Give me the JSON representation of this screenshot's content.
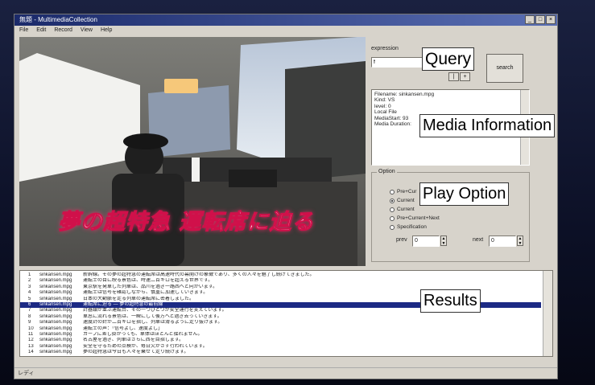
{
  "window": {
    "title": "無題 - MultimediaCollection",
    "controls": [
      "_",
      "□",
      "×"
    ]
  },
  "menu": [
    "File",
    "Edit",
    "Record",
    "View",
    "Help"
  ],
  "video": {
    "caption": "夢の超特急 運転席に迫る"
  },
  "query": {
    "label": "expression",
    "value": "f",
    "nav_prev": "|",
    "nav_next": "+",
    "search_button": "search",
    "callout": "Query"
  },
  "media_info": {
    "lines": [
      "Filename: sinkansen.mpg",
      "Kind: VS",
      "level: 0",
      "Local File",
      "MediaStart: 93",
      "Media Duration:"
    ],
    "callout": "Media Information"
  },
  "play_option": {
    "group_label": "Option",
    "options": [
      "Pre+Cur",
      "Current",
      "Current",
      "Pre+Current+Next",
      "Specification"
    ],
    "selected_index": 1,
    "prev_label": "prev",
    "prev_value": "0",
    "next_label": "next",
    "next_value": "0",
    "callout": "Play Option"
  },
  "results": {
    "rows": [
      {
        "n": "1",
        "file": "sinkansen.mpg",
        "text": "新幹線。その夢の超特急の運転席は高速時代の幕開けの象徴であり、多くの人々を魅了し続けてきました。"
      },
      {
        "n": "2",
        "file": "sinkansen.mpg",
        "text": "運転士の目に映る景色は、時速二百キロを超える世界です。"
      },
      {
        "n": "3",
        "file": "sinkansen.mpg",
        "text": "東京駅を発車した列車は、品川を過ぎ一路西へと向かいます。"
      },
      {
        "n": "4",
        "file": "sinkansen.mpg",
        "text": "運転士は信号を確認しながら、慎重に加速していきます。"
      },
      {
        "n": "5",
        "file": "sinkansen.mpg",
        "text": "日本の大動脈を走る列車の運転席に密着しました。"
      },
      {
        "n": "6",
        "file": "sinkansen.mpg",
        "text": "運転席に迫る ― 夢の超特急の最前線"
      },
      {
        "n": "7",
        "file": "sinkansen.mpg",
        "text": "計器類が並ぶ運転台、その一つひとつが安全運行を支えています。"
      },
      {
        "n": "8",
        "file": "sinkansen.mpg",
        "text": "車窓に流れる景色は、一瞬にして後方へと過ぎ去っていきます。"
      },
      {
        "n": "9",
        "file": "sinkansen.mpg",
        "text": "速度計の針が二百キロを指し、列車は滑るように走り抜けます。"
      },
      {
        "n": "10",
        "file": "sinkansen.mpg",
        "text": "運転士の声：「信号よし、速度よし」"
      },
      {
        "n": "11",
        "file": "sinkansen.mpg",
        "text": "カーブに差し掛かっても、車体はほとんど揺れません。"
      },
      {
        "n": "12",
        "file": "sinkansen.mpg",
        "text": "名古屋を過ぎ、列車はさらに西を目指します。"
      },
      {
        "n": "13",
        "file": "sinkansen.mpg",
        "text": "安全を守るための点検が、毎日欠かさず行われています。"
      },
      {
        "n": "14",
        "file": "sinkansen.mpg",
        "text": "夢の超特急は今日も人々を乗せて走り続けます。"
      }
    ],
    "selected_index": 5,
    "callout": "Results"
  },
  "status": "レディ"
}
